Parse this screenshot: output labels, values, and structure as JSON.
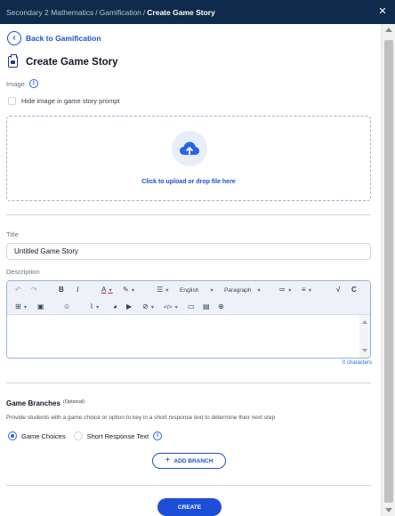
{
  "breadcrumb": {
    "items": [
      "Secondary 2 Mathematics",
      "Gamification"
    ],
    "separator": "/",
    "current": "Create Game Story"
  },
  "back_link": {
    "label": "Back to Gamification"
  },
  "page": {
    "title": "Create Game Story"
  },
  "image_section": {
    "label": "Image",
    "hide_checkbox_label": "Hide image in game story prompt",
    "hide_checked": false,
    "upload_text": "Click to upload or drop file here"
  },
  "title_field": {
    "label": "Title",
    "value": "Untitled Game Story"
  },
  "description_field": {
    "label": "Description",
    "language": "English",
    "block_format": "Paragraph",
    "char_count": "0 characters",
    "toolbar_icons": [
      "undo-icon",
      "redo-icon",
      "bold-icon",
      "italic-icon",
      "text-color-icon",
      "highlight-icon",
      "align-icon",
      "bullet-list-icon",
      "numbered-list-icon",
      "math-icon",
      "chemistry-icon",
      "table-icon",
      "save-icon",
      "emoji-icon",
      "attach-icon",
      "palette-icon",
      "media-icon",
      "link-icon",
      "code-icon",
      "comment-icon",
      "image-icon",
      "special-char-icon"
    ]
  },
  "branches": {
    "title": "Game Branches",
    "optional": "(Optional)",
    "description": "Provide students with a game choice or option to key in a short response text to determine their next step",
    "options": [
      {
        "label": "Game Choices",
        "selected": true
      },
      {
        "label": "Short Response Text",
        "selected": false
      }
    ],
    "add_label": "ADD BRANCH"
  },
  "actions": {
    "create_label": "CREATE"
  },
  "colors": {
    "header": "#0f2a4a",
    "accent": "#1d4ed8",
    "upload_border": "#9ab3d6"
  }
}
